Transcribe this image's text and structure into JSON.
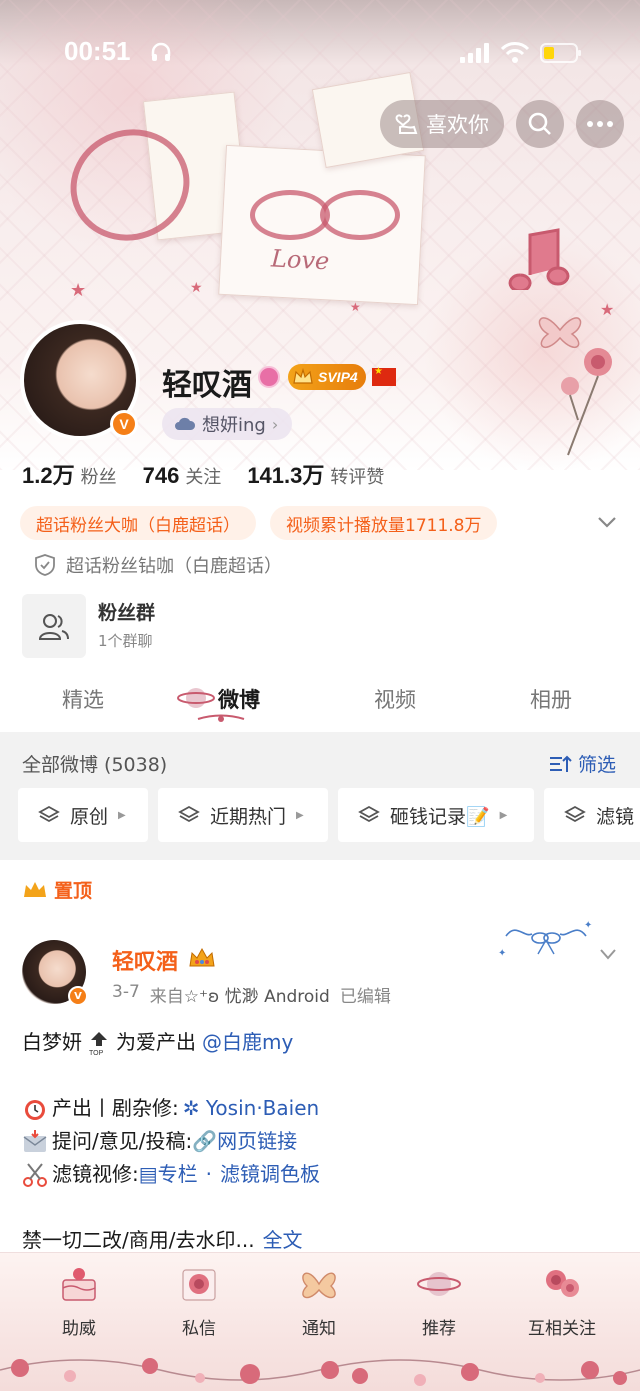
{
  "status_bar": {
    "time": "00:51",
    "icons": [
      "headphones-icon",
      "signal-icon",
      "wifi-icon",
      "battery-icon"
    ]
  },
  "header": {
    "like_label": "喜欢你",
    "icons": [
      "heart-hand-icon",
      "search-icon",
      "more-icon"
    ],
    "banner_script_text": "Love"
  },
  "profile": {
    "name": "轻叹酒",
    "vip_label": "SVIP4",
    "status": "想妍ing",
    "stats": [
      {
        "value": "1.2万",
        "label": "粉丝"
      },
      {
        "value": "746",
        "label": "关注"
      },
      {
        "value": "141.3万",
        "label": "转评赞"
      }
    ],
    "tags": [
      "超话粉丝大咖（白鹿超话）",
      "视频累计播放量1711.8万"
    ],
    "honor": "超话粉丝钻咖（白鹿超话）",
    "fans_group": {
      "title": "粉丝群",
      "subtitle": "1个群聊"
    }
  },
  "tabs": [
    "精选",
    "微博",
    "视频",
    "相册"
  ],
  "active_tab": "微博",
  "feed": {
    "header_label": "全部微博 (5038)",
    "filter_label": "筛选",
    "chips": [
      "原创",
      "近期热门",
      "砸钱记录📝",
      "滤镜"
    ]
  },
  "post": {
    "pinned_label": "置顶",
    "author": "轻叹酒",
    "date": "3-7",
    "source_prefix": "来自",
    "source": "☆⁺ʚ 忧渺 Android",
    "edited": "已编辑",
    "line1_text": "白梦妍",
    "line1_mid": "为爱产出",
    "line1_mention": "@白鹿my",
    "line2_label": "产出丨剧杂修:",
    "line2_link": "Yosin·Baien",
    "line3_label": "提问/意见/投稿:",
    "line3_link": "网页链接",
    "line4_label": "滤镜视修:",
    "line4_link1": "专栏",
    "line4_sep": "·",
    "line4_link2": "滤镜调色板",
    "line5_text": "禁一切二改/商用/去水印...",
    "line5_more": "全文"
  },
  "bottom_bar": [
    {
      "label": "助威",
      "icon": "cake-icon"
    },
    {
      "label": "私信",
      "icon": "rose-icon"
    },
    {
      "label": "通知",
      "icon": "butterfly-icon"
    },
    {
      "label": "推荐",
      "icon": "planet-icon"
    },
    {
      "label": "互相关注",
      "icon": "roses-icon"
    }
  ],
  "colors": {
    "accent_orange": "#f4601a",
    "link_blue": "#2d5db5",
    "vip_gold": "#f3a31a",
    "rose": "#c85a6e"
  }
}
